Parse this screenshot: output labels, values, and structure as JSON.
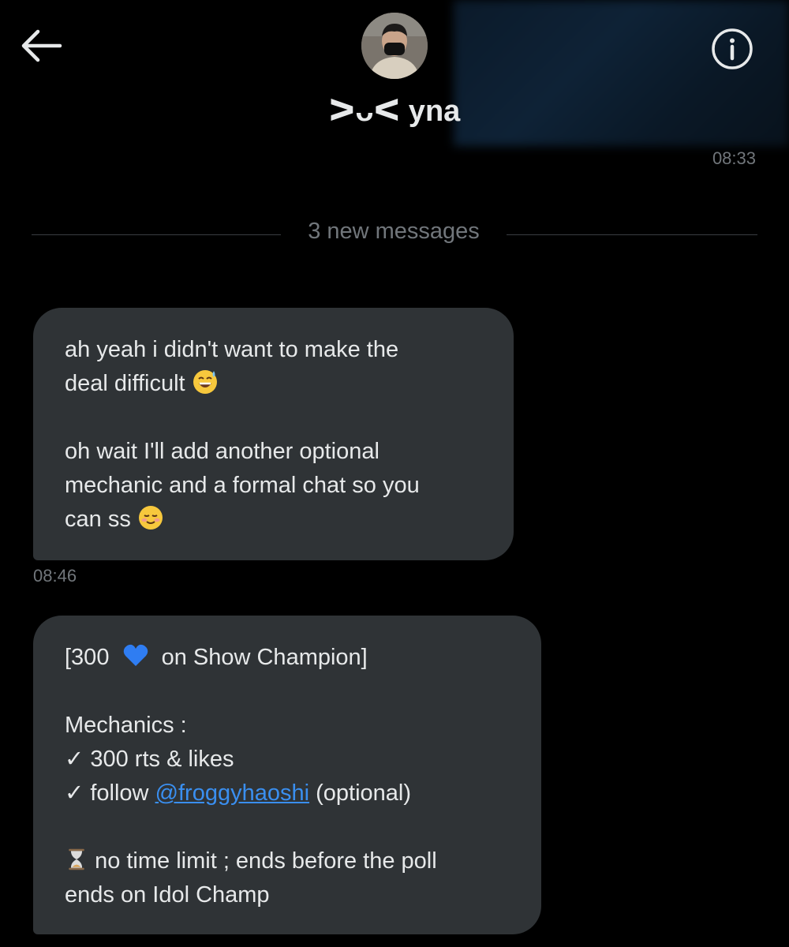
{
  "header": {
    "display_name": "ᐳᴗᐸ yna",
    "back_icon": "arrow-left-icon",
    "info_icon": "info-circle-icon"
  },
  "timestamps": {
    "top": "08:33",
    "after_first": "08:46"
  },
  "divider": {
    "text": "3 new messages"
  },
  "messages": [
    {
      "line1": "ah yeah i didn't want to make the",
      "line2": "deal difficult",
      "emoji1": "grinning-sweat-emoji",
      "line3": "oh wait I'll add another optional",
      "line4": "mechanic and a formal chat so you",
      "line5": "can ss",
      "emoji2": "smiling-blush-emoji"
    },
    {
      "title_pre": "[300",
      "heart": "blue-heart-emoji",
      "title_post": "on Show Champion]",
      "mech_label": "Mechanics :",
      "item1": "✓ 300 rts & likes",
      "item2_pre": "✓ follow",
      "item2_link": "@froggyhaoshi",
      "item2_post": "(optional)",
      "hourglass": "hourglass-emoji",
      "limit_line1": "no time limit ; ends before the poll",
      "limit_line2": "ends on Idol Champ"
    }
  ],
  "colors": {
    "bubble": "#2f3336",
    "link": "#3a8ff0",
    "meta": "#71767b"
  }
}
